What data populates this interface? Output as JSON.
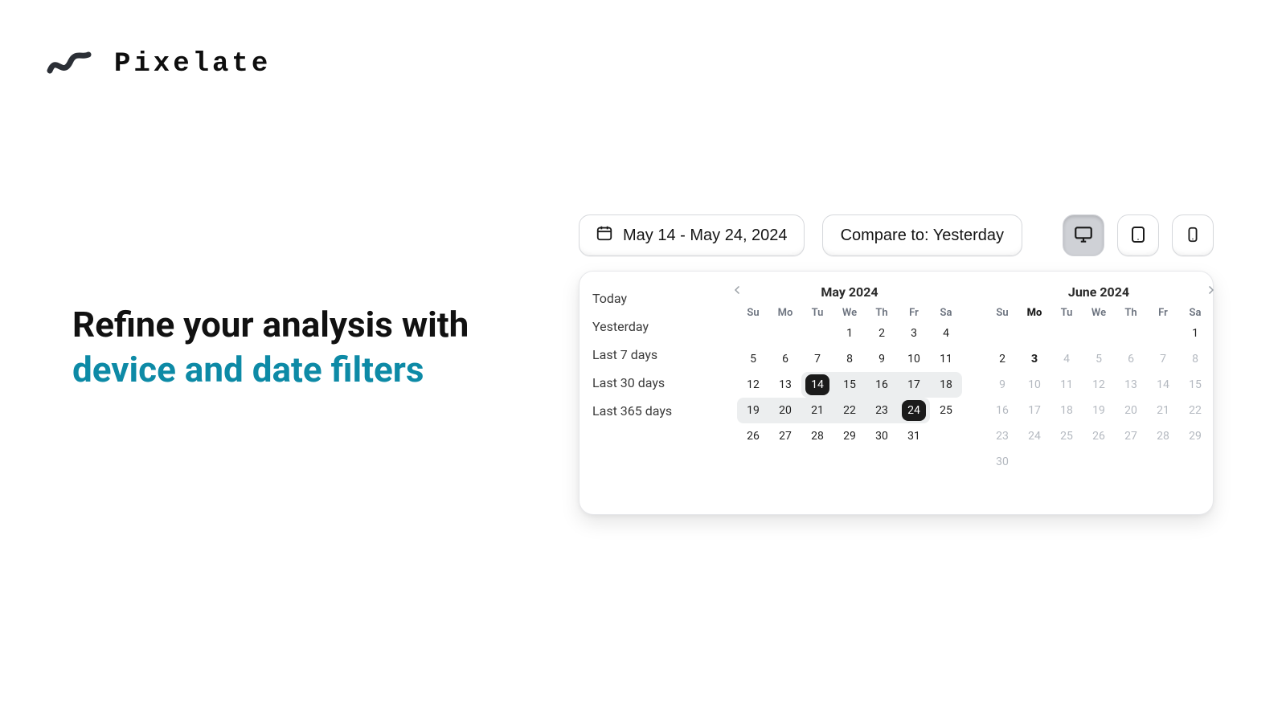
{
  "brand": {
    "name": "Pixelate"
  },
  "headline": {
    "line1": "Refine your analysis with",
    "line2": "device and date filters"
  },
  "colors": {
    "accent": "#0d8aa6",
    "card_border": "#e6e7ea",
    "pill_border": "#d6d8dc",
    "sel_bg": "#1b1b1b",
    "range_bg": "#eceeef"
  },
  "daterange": {
    "label": "May 14 - May 24, 2024"
  },
  "compare": {
    "label": "Compare to: Yesterday"
  },
  "devices": {
    "desktop_active": true,
    "labels": {
      "desktop": "Desktop",
      "tablet": "Tablet",
      "mobile": "Mobile"
    }
  },
  "presets": [
    "Today",
    "Yesterday",
    "Last 7 days",
    "Last 30 days",
    "Last 365 days"
  ],
  "weekday_labels": [
    "Su",
    "Mo",
    "Tu",
    "We",
    "Th",
    "Fr",
    "Sa"
  ],
  "months": {
    "left": {
      "title": "May 2024",
      "weekday_bold_index": null,
      "leading_blanks": 3,
      "days": 31,
      "dim_days": [],
      "selected": [
        14,
        24
      ],
      "range": {
        "start": 14,
        "end": 24
      },
      "extra_range": [
        19
      ],
      "bold_days": []
    },
    "right": {
      "title": "June 2024",
      "weekday_bold_index": 1,
      "leading_blanks": 6,
      "days": 30,
      "dim_days": [
        4,
        5,
        6,
        7,
        8,
        9,
        10,
        11,
        12,
        13,
        14,
        15,
        16,
        17,
        18,
        19,
        20,
        21,
        22,
        23,
        24,
        25,
        26,
        27,
        28,
        29,
        30
      ],
      "selected": [],
      "range": null,
      "extra_range": [],
      "bold_days": [
        3
      ]
    }
  }
}
